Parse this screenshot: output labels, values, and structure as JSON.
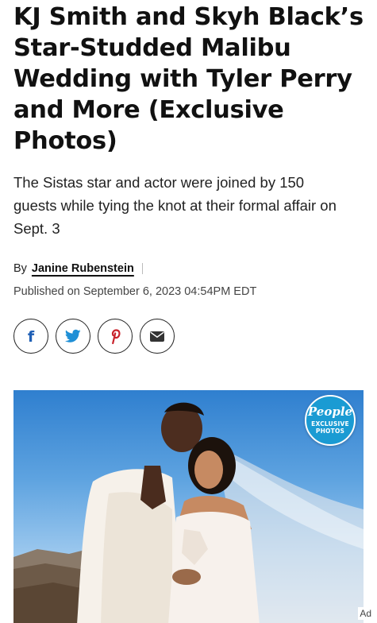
{
  "article": {
    "headline": "KJ Smith and Skyh Black’s Star-Studded Malibu Wedding with Tyler Perry and More (Exclusive Photos)",
    "dek": "The Sistas star and actor were joined by 150 guests while tying the knot at their formal affair on Sept. 3",
    "byline_prefix": "By",
    "author": "Janine Rubenstein",
    "published": "Published on September 6, 2023 04:54PM EDT"
  },
  "share": [
    {
      "name": "facebook",
      "icon": "facebook-icon",
      "glyph": "f",
      "color": "#1f5fb5"
    },
    {
      "name": "twitter",
      "icon": "twitter-icon",
      "color": "#1f8fd6"
    },
    {
      "name": "pinterest",
      "icon": "pinterest-icon",
      "glyph": "P",
      "color": "#c8232c"
    },
    {
      "name": "email",
      "icon": "email-icon",
      "color": "#333333"
    }
  ],
  "hero": {
    "badge": {
      "brand": "People",
      "line1": "EXCLUSIVE",
      "line2": "PHOTOS"
    },
    "ad_label": "Ad"
  },
  "colors": {
    "badge_blue": "#1a9bd3",
    "sky_top": "#2f7fcf"
  }
}
